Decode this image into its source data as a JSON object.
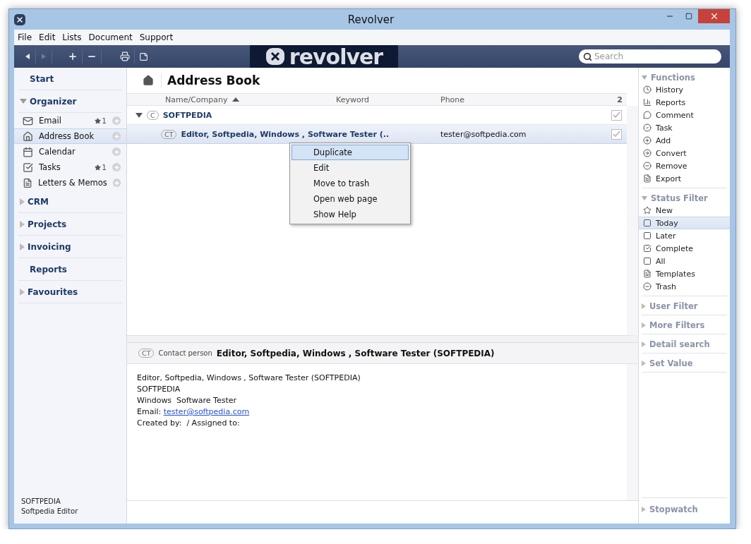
{
  "window": {
    "title": "Revolver"
  },
  "menu": [
    "File",
    "Edit",
    "Lists",
    "Document",
    "Support"
  ],
  "logo": "revolver",
  "search": {
    "placeholder": "Search"
  },
  "sidebar": {
    "sections": [
      {
        "kind": "link",
        "label": "Start"
      },
      {
        "kind": "group",
        "label": "Organizer",
        "expanded": true,
        "items": [
          {
            "label": "Email",
            "count": "1",
            "selected": false
          },
          {
            "label": "Address Book",
            "selected": true
          },
          {
            "label": "Calendar",
            "selected": false
          },
          {
            "label": "Tasks",
            "count": "1",
            "selected": false
          },
          {
            "label": "Letters & Memos",
            "selected": false
          }
        ]
      },
      {
        "kind": "group",
        "label": "CRM",
        "expanded": false
      },
      {
        "kind": "group",
        "label": "Projects",
        "expanded": false
      },
      {
        "kind": "group",
        "label": "Invoicing",
        "expanded": false
      },
      {
        "kind": "link",
        "label": "Reports"
      },
      {
        "kind": "group",
        "label": "Favourites",
        "expanded": false
      }
    ],
    "footer": [
      "SOFTPEDIA",
      "Softpedia Editor"
    ]
  },
  "page": {
    "title": "Address Book"
  },
  "table": {
    "columns": [
      {
        "label": "Name/Company",
        "sorted": true
      },
      {
        "label": "Keyword",
        "sorted": false
      },
      {
        "label": "Phone",
        "sorted": false
      }
    ],
    "count": "2",
    "rows": [
      {
        "kind": "group",
        "badge": "C",
        "name": "SOFTPEDIA",
        "expanded": true,
        "checked": true,
        "selected": false
      },
      {
        "kind": "contact",
        "badge": "CT",
        "name": "Editor, Softpedia, Windows , Software Tester (..",
        "keyword": "",
        "phone": "tester@softpedia.com",
        "checked": true,
        "selected": true
      }
    ]
  },
  "context_menu": [
    {
      "label": "Duplicate",
      "selected": true
    },
    {
      "label": "Edit",
      "selected": false
    },
    {
      "label": "Move to trash",
      "selected": false
    },
    {
      "label": "Open web page",
      "selected": false
    },
    {
      "label": "Show Help",
      "selected": false
    }
  ],
  "detail": {
    "badge": "CT",
    "type": "Contact person",
    "title": "Editor, Softpedia, Windows , Software Tester (SOFTPEDIA)",
    "lines": [
      {
        "text": "Editor, Softpedia, Windows , Software Tester (SOFTPEDIA)"
      },
      {
        "text": "SOFTPEDIA"
      },
      {
        "text": "Windows  Software Tester"
      },
      {
        "text": "Email: ",
        "link": "tester@softpedia.com"
      },
      {
        "text": "Created by:  / Assigned to:"
      }
    ]
  },
  "right_panel": {
    "sections": [
      {
        "label": "Functions",
        "expanded": true,
        "kind": "actions",
        "items": [
          {
            "label": "History"
          },
          {
            "label": "Reports"
          },
          {
            "label": "Comment"
          },
          {
            "label": "Task"
          },
          {
            "label": "Add"
          },
          {
            "label": "Convert"
          },
          {
            "label": "Remove"
          },
          {
            "label": "Export"
          }
        ]
      },
      {
        "label": "Status Filter",
        "expanded": true,
        "kind": "filters",
        "items": [
          {
            "label": "New",
            "selected": false
          },
          {
            "label": "Today",
            "selected": true
          },
          {
            "label": "Later",
            "selected": false
          },
          {
            "label": "Complete",
            "selected": false
          },
          {
            "label": "All",
            "selected": false
          },
          {
            "label": "Templates",
            "selected": false
          },
          {
            "label": "Trash",
            "selected": false
          }
        ]
      },
      {
        "label": "User Filter",
        "expanded": false
      },
      {
        "label": "More Filters",
        "expanded": false
      },
      {
        "label": "Detail search",
        "expanded": false
      },
      {
        "label": "Set Value",
        "expanded": false
      }
    ],
    "footer": {
      "label": "Stopwatch",
      "expanded": false
    }
  }
}
